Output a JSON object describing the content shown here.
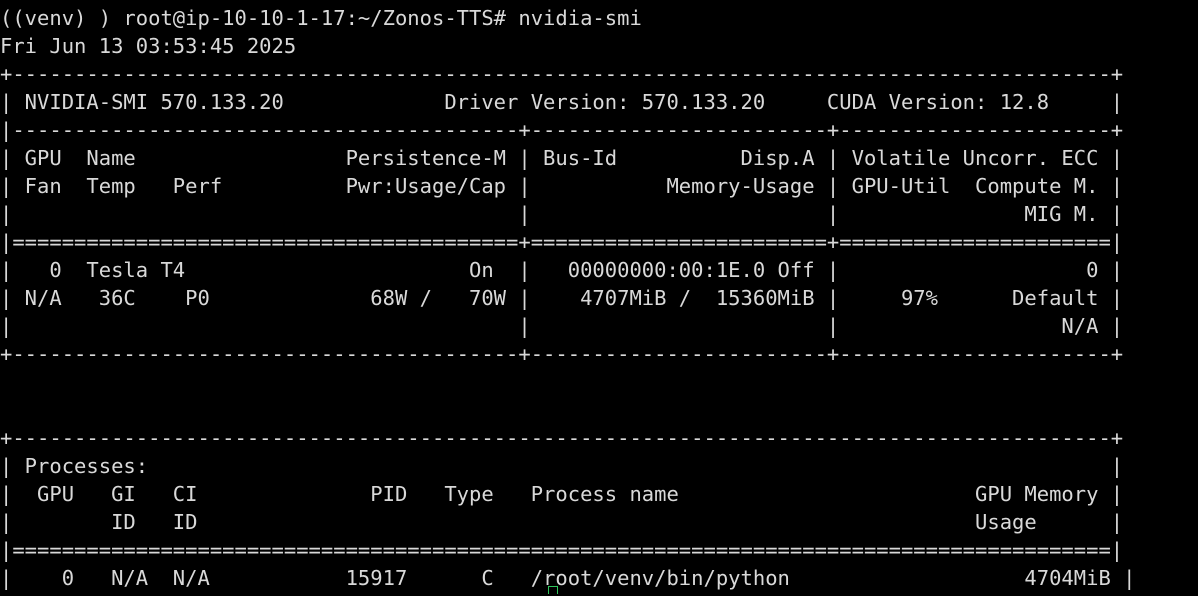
{
  "terminal": {
    "prompt": "((venv) ) root@ip-10-10-1-17:~/Zonos-TTS# nvidia-smi",
    "timestamp": "Fri Jun 13 03:53:45 2025",
    "gpu_table": {
      "border_top": "+-----------------------------------------------------------------------------------------+",
      "version_row": "| NVIDIA-SMI 570.133.20             Driver Version: 570.133.20     CUDA Version: 12.8     |",
      "header_separator": "|-----------------------------------------+------------------------+----------------------+",
      "header_row1": "| GPU  Name                 Persistence-M | Bus-Id          Disp.A | Volatile Uncorr. ECC |",
      "header_row2": "| Fan  Temp   Perf          Pwr:Usage/Cap |           Memory-Usage | GPU-Util  Compute M. |",
      "header_row3": "|                                         |                        |               MIG M. |",
      "double_separator": "|=========================================+========================+======================|",
      "gpu_row1": "|   0  Tesla T4                       On  |   00000000:00:1E.0 Off |                    0 |",
      "gpu_row2": "| N/A   36C    P0             68W /   70W |    4707MiB /  15360MiB |     97%      Default |",
      "gpu_row3": "|                                         |                        |                  N/A |",
      "border_bottom": "+-----------------------------------------+------------------------+----------------------+"
    },
    "blank": "",
    "process_table": {
      "border_top": "+-----------------------------------------------------------------------------------------+",
      "title_row": "| Processes:                                                                              |",
      "header_row1": "|  GPU   GI   CI              PID   Type   Process name                        GPU Memory |",
      "header_row2": "|        ID   ID                                                               Usage      |",
      "double_separator": "|=========================================================================================|",
      "process_row1": "|    0   N/A  N/A           15917      C   /root/venv/bin/python                   4704MiB |",
      "border_bottom": "+-----------------------------------------------------------------------------------------+"
    },
    "colors": {
      "background": "#000000",
      "foreground": "#d9d9d9",
      "cursor": "#2ec45a"
    }
  }
}
